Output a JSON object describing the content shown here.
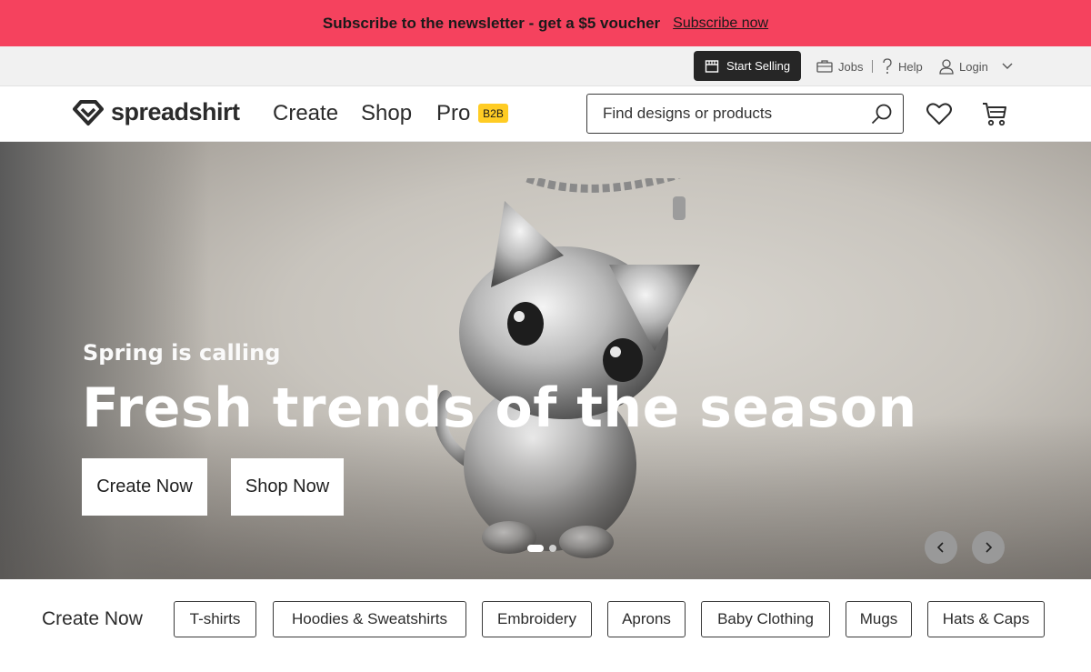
{
  "promo": {
    "text": "Subscribe to the newsletter - get a $5 voucher",
    "link": "Subscribe now",
    "bg_color": "#f5425e"
  },
  "utility": {
    "start_selling": "Start Selling",
    "jobs": "Jobs",
    "help": "Help",
    "login": "Login"
  },
  "nav": {
    "logo": "spreadshirt",
    "items": [
      "Create",
      "Shop",
      "Pro"
    ],
    "badge": "B2B",
    "search_placeholder": "Find designs or products"
  },
  "hero": {
    "eyebrow": "Spring is calling",
    "title": "Fresh trends of the season",
    "buttons": [
      "Create Now",
      "Shop Now"
    ],
    "slides_total": 2,
    "slide_active": 1
  },
  "categories": {
    "label": "Create Now",
    "items": [
      "T-shirts",
      "Hoodies & Sweatshirts",
      "Embroidery",
      "Aprons",
      "Baby Clothing",
      "Mugs",
      "Hats & Caps"
    ]
  },
  "colors": {
    "accent_badge": "#ffcc24",
    "dark_button": "#262626"
  }
}
